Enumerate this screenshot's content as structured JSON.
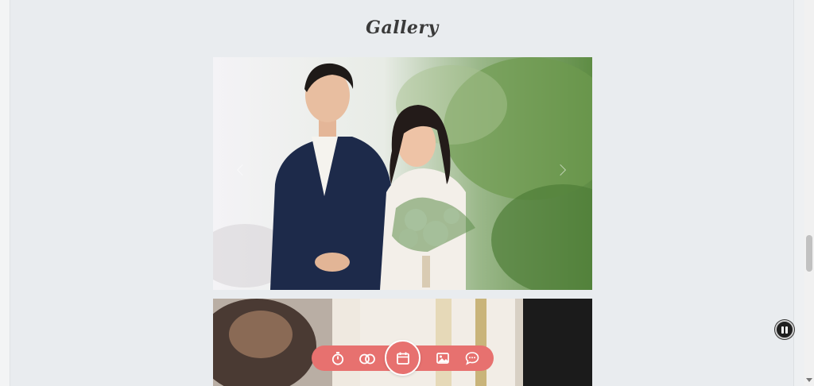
{
  "gallery": {
    "title": "Gallery",
    "photos": [
      {
        "subject": "couple-portrait"
      },
      {
        "subject": "ceremony"
      }
    ]
  },
  "bottom_nav": {
    "items": [
      {
        "icon": "stopwatch-icon"
      },
      {
        "icon": "rings-icon"
      },
      {
        "icon": "calendar-icon",
        "active": true
      },
      {
        "icon": "image-icon"
      },
      {
        "icon": "chat-icon"
      }
    ],
    "accent": "#e7716f"
  },
  "music": {
    "icon": "pause-icon"
  }
}
